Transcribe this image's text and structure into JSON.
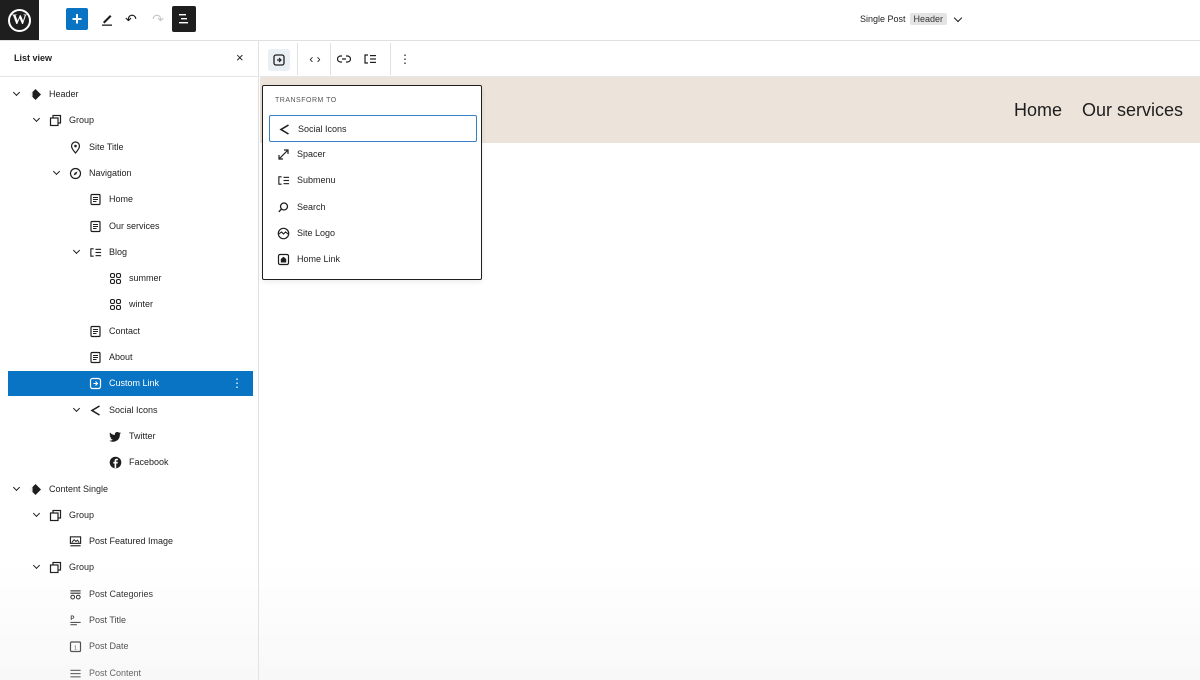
{
  "topbar": {
    "logo_letter": "W",
    "add_label": "+",
    "undo_glyph": "↶",
    "redo_glyph": "↷",
    "doc_title": "Single Post",
    "doc_badge": "Header"
  },
  "list_view": {
    "title": "List view",
    "close_glyph": "×",
    "items": [
      {
        "label": "Header",
        "icon": "template-part-icon",
        "level": 0,
        "expanded": true
      },
      {
        "label": "Group",
        "icon": "group-icon",
        "level": 1,
        "expanded": true
      },
      {
        "label": "Site Title",
        "icon": "map-pin-icon",
        "level": 2,
        "expanded": false
      },
      {
        "label": "Navigation",
        "icon": "compass-icon",
        "level": 2,
        "expanded": true
      },
      {
        "label": "Home",
        "icon": "page-icon",
        "level": 3,
        "expanded": false
      },
      {
        "label": "Our services",
        "icon": "page-icon",
        "level": 3,
        "expanded": false
      },
      {
        "label": "Blog",
        "icon": "submenu-icon",
        "level": 3,
        "expanded": true
      },
      {
        "label": "summer",
        "icon": "category-icon",
        "level": 4,
        "expanded": false
      },
      {
        "label": "winter",
        "icon": "category-icon",
        "level": 4,
        "expanded": false
      },
      {
        "label": "Contact",
        "icon": "page-icon",
        "level": 3,
        "expanded": false
      },
      {
        "label": "About",
        "icon": "page-icon",
        "level": 3,
        "expanded": false
      },
      {
        "label": "Custom Link",
        "icon": "custom-link-icon",
        "level": 3,
        "expanded": false,
        "selected": true
      },
      {
        "label": "Social Icons",
        "icon": "share-icon",
        "level": 3,
        "expanded": true
      },
      {
        "label": "Twitter",
        "icon": "twitter-icon",
        "level": 4,
        "expanded": false
      },
      {
        "label": "Facebook",
        "icon": "facebook-icon",
        "level": 4,
        "expanded": false
      },
      {
        "label": "Content Single",
        "icon": "template-part-icon",
        "level": 0,
        "expanded": true
      },
      {
        "label": "Group",
        "icon": "group-icon",
        "level": 1,
        "expanded": true
      },
      {
        "label": "Post Featured Image",
        "icon": "featured-image-icon",
        "level": 2,
        "expanded": false
      },
      {
        "label": "Group",
        "icon": "group-icon",
        "level": 1,
        "expanded": true
      },
      {
        "label": "Post Categories",
        "icon": "post-categories-icon",
        "level": 2,
        "expanded": false
      },
      {
        "label": "Post Title",
        "icon": "post-title-icon",
        "level": 2,
        "expanded": false
      },
      {
        "label": "Post Date",
        "icon": "post-date-icon",
        "level": 2,
        "expanded": false
      },
      {
        "label": "Post Content",
        "icon": "post-content-icon",
        "level": 2,
        "expanded": false
      }
    ],
    "more_glyph": "⋮"
  },
  "block_toolbar": {
    "code_glyph": "‹ ›",
    "link_glyph": "⊖",
    "more_glyph": "⋮"
  },
  "transform": {
    "heading": "Transform to",
    "items": [
      {
        "label": "Social Icons",
        "icon": "share-icon",
        "focused": true
      },
      {
        "label": "Spacer",
        "icon": "resize-icon"
      },
      {
        "label": "Submenu",
        "icon": "submenu-icon"
      },
      {
        "label": "Search",
        "icon": "search-icon"
      },
      {
        "label": "Site Logo",
        "icon": "site-logo-icon"
      },
      {
        "label": "Home Link",
        "icon": "home-icon"
      }
    ]
  },
  "canvas": {
    "nav_links": [
      "Home",
      "Our services"
    ]
  },
  "colors": {
    "accent": "#0a74c4",
    "header_bg": "#ece4da",
    "dark": "#1e1e1e"
  }
}
